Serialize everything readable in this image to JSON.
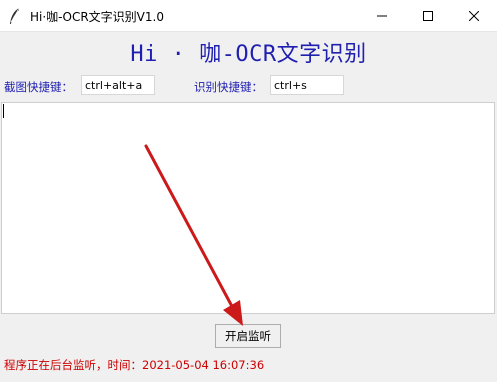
{
  "window": {
    "title": "Hi·咖-OCR文字识别V1.0"
  },
  "header": {
    "title": "Hi · 咖-OCR文字识别"
  },
  "hotkeys": {
    "capture_label": "截图快捷键：",
    "capture_value": "ctrl+alt+a",
    "recognize_label": "识别快捷键：",
    "recognize_value": "ctrl+s"
  },
  "output": {
    "text": ""
  },
  "controls": {
    "listen_button": "开启监听"
  },
  "status": {
    "text": "程序正在后台监听，时间：2021-05-04 16:07:36"
  },
  "colors": {
    "accent": "#1f1fb0",
    "status": "#cc0000",
    "annotation_arrow": "#cc1a1a",
    "background": "#f0f0f0"
  },
  "icons": {
    "app": "feather-icon",
    "minimize": "minimize-icon",
    "maximize": "maximize-icon",
    "close": "close-icon"
  }
}
